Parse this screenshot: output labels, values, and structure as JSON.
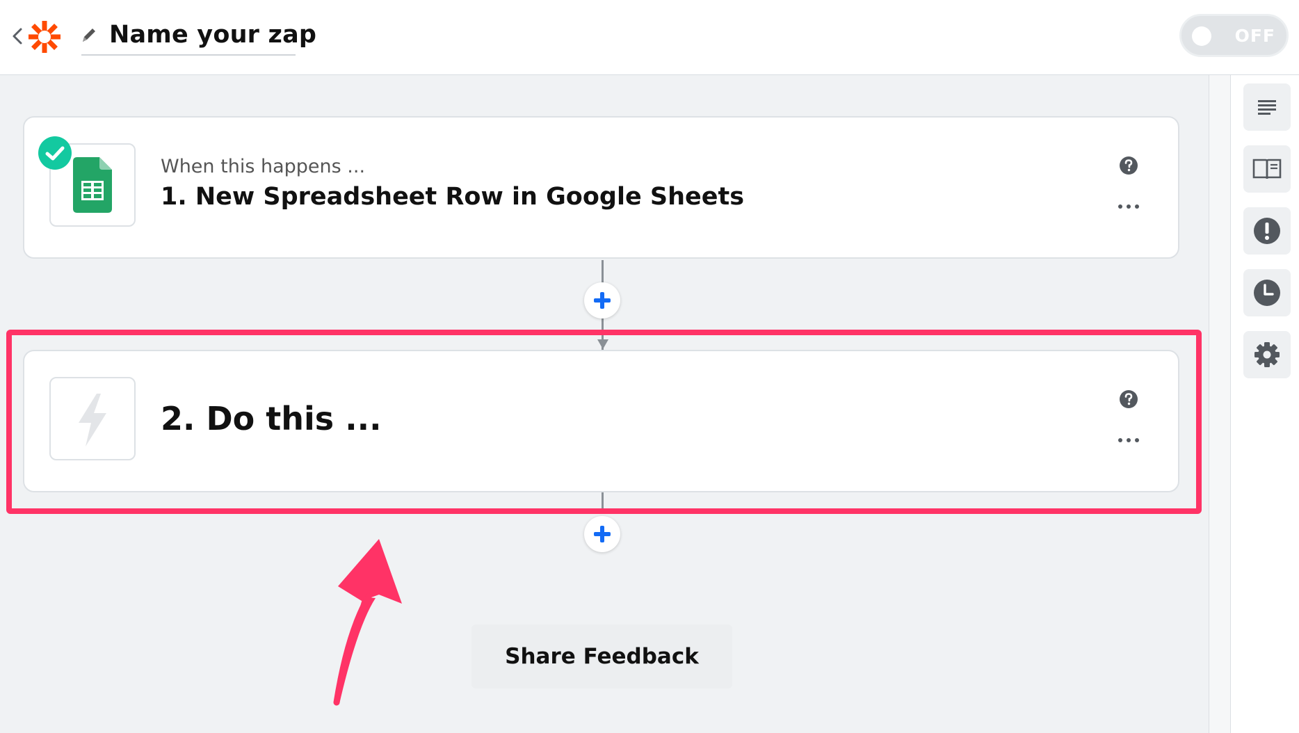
{
  "header": {
    "zap_name": "Name your zap",
    "toggle_label": "OFF"
  },
  "steps": [
    {
      "subtitle": "When this happens ...",
      "title": "1. New Spreadsheet Row in Google Sheets",
      "app_icon": "google-sheets-icon",
      "status_icon": "check-icon"
    },
    {
      "title": "2. Do this ...",
      "app_icon": "lightning-icon"
    }
  ],
  "sidebar": {
    "icons": [
      "list-icon",
      "book-icon",
      "alert-icon",
      "clock-icon",
      "gear-icon"
    ]
  },
  "feedback_label": "Share Feedback",
  "colors": {
    "brand_orange": "#ff4a00",
    "highlight": "#ff3366",
    "success_teal": "#13c9a0",
    "sheets_green": "#23a566",
    "add_blue": "#136bf5"
  }
}
